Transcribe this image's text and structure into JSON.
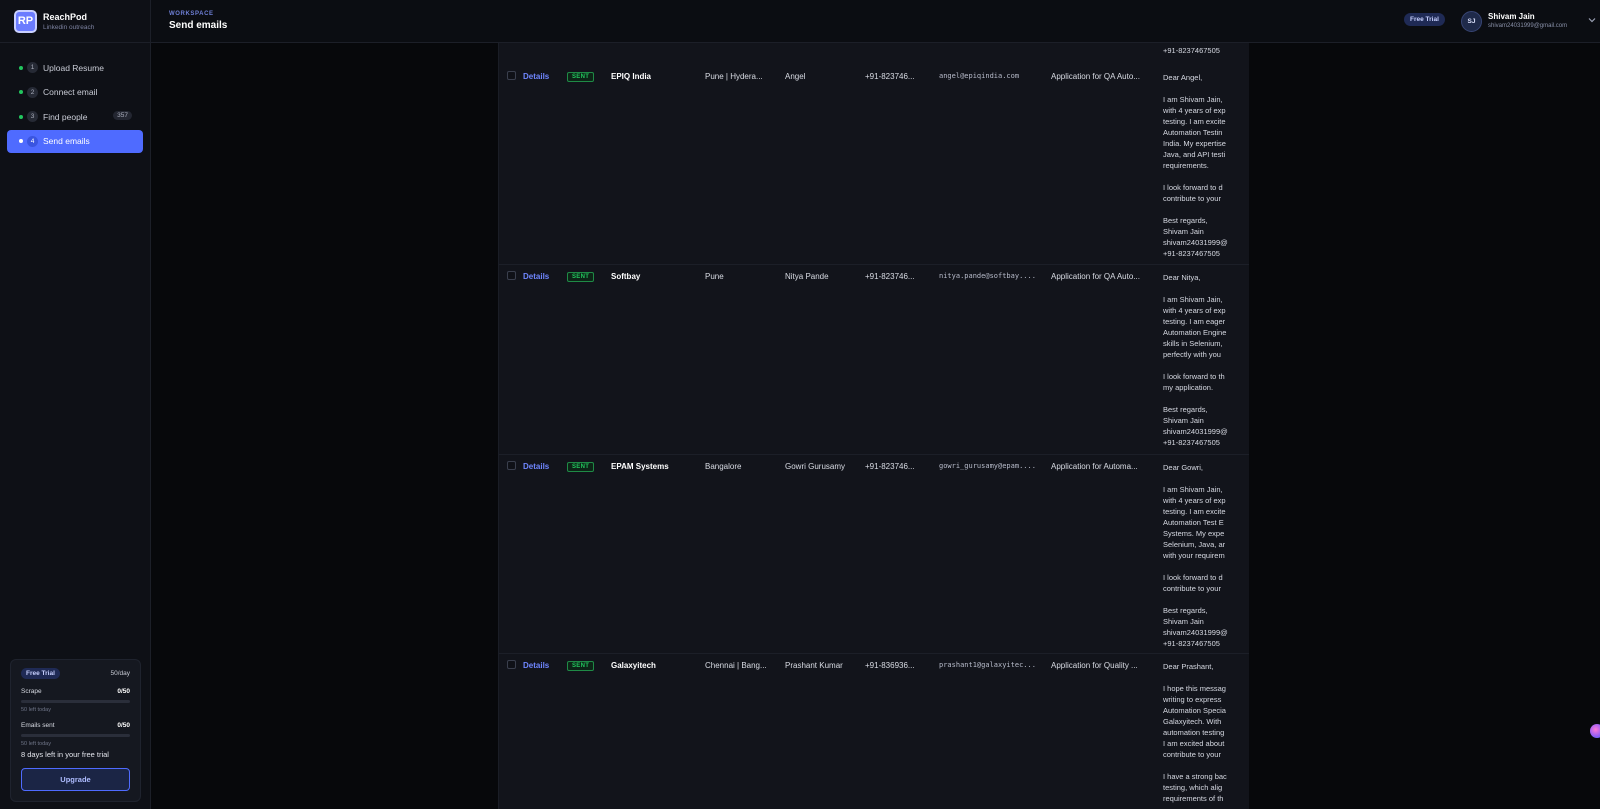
{
  "brand": {
    "logo": "RP",
    "name": "ReachPod",
    "subtitle": "Linkedin outreach"
  },
  "steps": [
    {
      "num": "1",
      "label": "Upload Resume",
      "status": "done"
    },
    {
      "num": "2",
      "label": "Connect email",
      "status": "done"
    },
    {
      "num": "3",
      "label": "Find people",
      "status": "done",
      "count": "357"
    },
    {
      "num": "4",
      "label": "Send emails",
      "status": "active"
    }
  ],
  "trial": {
    "badge": "Free Trial",
    "per_day": "50/day",
    "scrape": {
      "label": "Scrape",
      "value": "0/50",
      "note": "50 left today",
      "fraction": 0
    },
    "emails": {
      "label": "Emails sent",
      "value": "0/50",
      "note": "50 left today",
      "fraction": 0
    },
    "days_left": "8 days left in your free trial",
    "upgrade_label": "Upgrade"
  },
  "header": {
    "workspace_label": "WORKSPACE",
    "title": "Send emails",
    "trial_badge": "Free Trial",
    "user": {
      "initials": "SJ",
      "name": "Shivam Jain",
      "email": "shivam24031999@gmail.com"
    }
  },
  "table": {
    "top_partial_line": "+91-8237467505",
    "rows": [
      {
        "details": "Details",
        "status": "SENT",
        "company": "EPIQ India",
        "location": "Pune | Hydera...",
        "person": "Angel",
        "phone": "+91-823746...",
        "email": "angel@epiqindia.com",
        "subject": "Application for QA Auto...",
        "body": "Dear Angel,\n\nI am Shivam Jain,\nwith 4 years of exp\ntesting. I am excite\nAutomation Testin\nIndia. My expertise\nJava, and API testi\nrequirements.\n\nI look forward to d\ncontribute to your\n\nBest regards,\nShivam Jain\nshivam24031999@\n+91-8237467505"
      },
      {
        "details": "Details",
        "status": "SENT",
        "company": "Softbay",
        "location": "Pune",
        "person": "Nitya Pande",
        "phone": "+91-823746...",
        "email": "nitya.pande@softbay....",
        "subject": "Application for QA Auto...",
        "body": "Dear Nitya,\n\nI am Shivam Jain,\nwith 4 years of exp\ntesting. I am eager\nAutomation Engine\nskills in Selenium,\nperfectly with you\n\nI look forward to th\nmy application.\n\nBest regards,\nShivam Jain\nshivam24031999@\n+91-8237467505"
      },
      {
        "details": "Details",
        "status": "SENT",
        "company": "EPAM Systems",
        "location": "Bangalore",
        "person": "Gowri Gurusamy",
        "phone": "+91-823746...",
        "email": "gowri_gurusamy@epam....",
        "subject": "Application for Automa...",
        "body": "Dear Gowri,\n\nI am Shivam Jain,\nwith 4 years of exp\ntesting. I am excite\nAutomation Test E\nSystems. My expe\nSelenium, Java, ar\nwith your requirem\n\nI look forward to d\ncontribute to your\n\nBest regards,\nShivam Jain\nshivam24031999@\n+91-8237467505"
      },
      {
        "details": "Details",
        "status": "SENT",
        "company": "Galaxyitech",
        "location": "Chennai | Bang...",
        "person": "Prashant Kumar",
        "phone": "+91-836936...",
        "email": "prashant1@galaxyitec...",
        "subject": "Application for Quality ...",
        "body": "Dear Prashant,\n\nI hope this messag\nwriting to express\nAutomation Specia\nGalaxyitech. With\nautomation testing\nI am excited about\ncontribute to your\n\nI have a strong bac\ntesting, which alig\nrequirements of th"
      }
    ]
  },
  "colors": {
    "accent": "#4f6bff",
    "sent": "#22c55e",
    "background": "#07080b"
  }
}
